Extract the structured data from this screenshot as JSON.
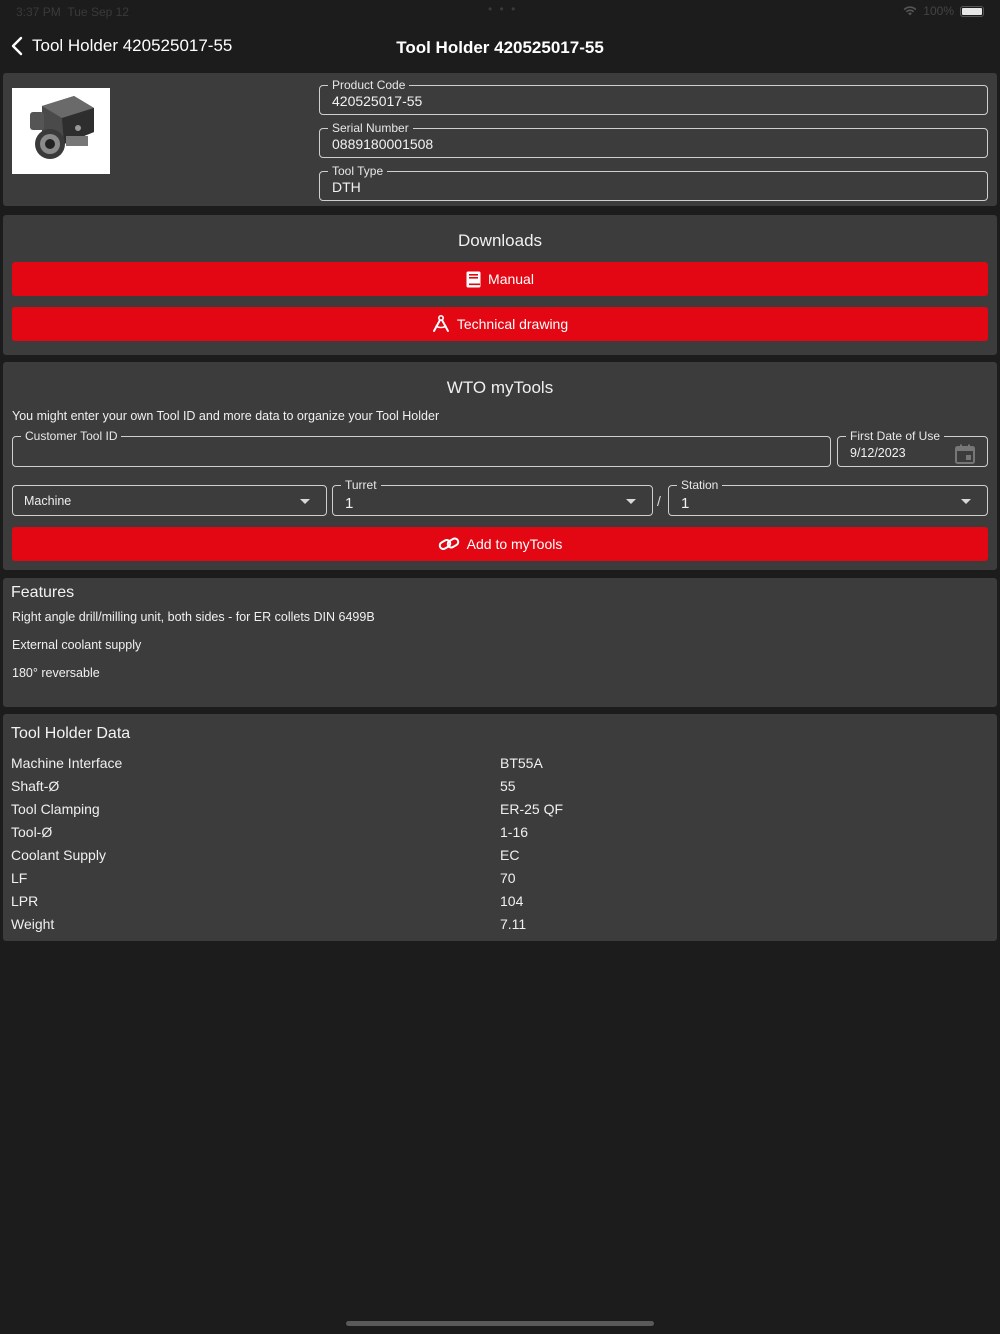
{
  "status_bar": {
    "time": "3:37 PM",
    "date": "Tue Sep 12",
    "battery": "100%",
    "dots": "• • •"
  },
  "nav": {
    "back_label": "Tool Holder 420525017-55",
    "title": "Tool Holder 420525017-55"
  },
  "product": {
    "product_code_label": "Product Code",
    "product_code": "420525017-55",
    "serial_number_label": "Serial Number",
    "serial_number": "0889180001508",
    "tool_type_label": "Tool Type",
    "tool_type": "DTH"
  },
  "downloads": {
    "title": "Downloads",
    "manual_label": "Manual",
    "technical_drawing_label": "Technical drawing"
  },
  "mytools": {
    "title": "WTO myTools",
    "hint": "You might enter your own Tool ID and more data to organize your Tool Holder",
    "customer_tool_id_label": "Customer Tool ID",
    "customer_tool_id": "",
    "first_date_label": "First Date of Use",
    "first_date": "9/12/2023",
    "machine_placeholder": "Machine",
    "turret_label": "Turret",
    "turret": "1",
    "separator": "/",
    "station_label": "Station",
    "station": "1",
    "add_label": "Add to myTools"
  },
  "features": {
    "title": "Features",
    "items": [
      "Right angle drill/milling unit, both sides - for ER collets DIN 6499B",
      "External coolant supply",
      "180° reversable"
    ]
  },
  "tool_holder_data": {
    "title": "Tool Holder Data",
    "rows": [
      {
        "key": "Machine Interface",
        "value": "BT55A"
      },
      {
        "key": "Shaft-Ø",
        "value": "55"
      },
      {
        "key": "Tool Clamping",
        "value": "ER-25 QF"
      },
      {
        "key": "Tool-Ø",
        "value": "1-16"
      },
      {
        "key": "Coolant Supply",
        "value": "EC"
      },
      {
        "key": "LF",
        "value": "70"
      },
      {
        "key": "LPR",
        "value": "104"
      },
      {
        "key": "Weight",
        "value": "7.11"
      }
    ]
  },
  "colors": {
    "accent": "#e30613",
    "card": "#3c3c3c",
    "background": "#1c1c1c"
  }
}
